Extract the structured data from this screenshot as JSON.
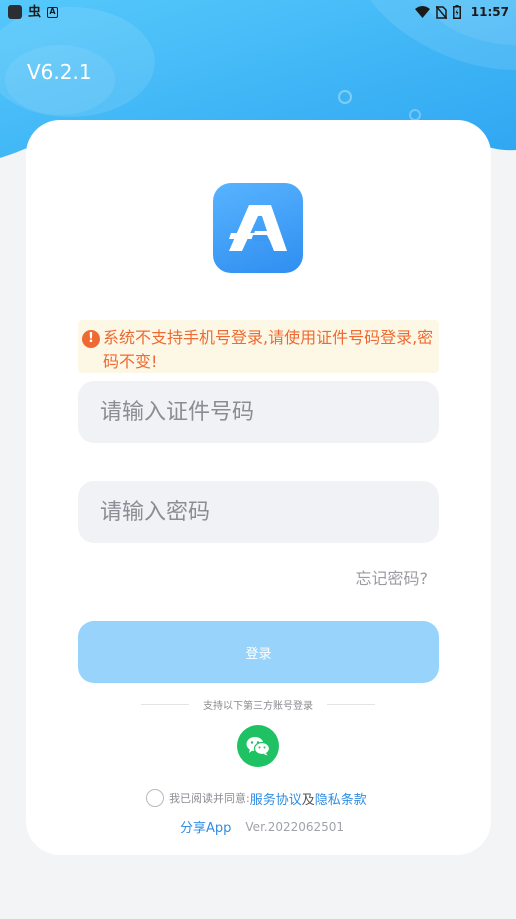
{
  "status_bar": {
    "left_glyph": "虫",
    "left_badge": "A",
    "time": "11:57"
  },
  "header": {
    "version": "V6.2.1"
  },
  "notice": {
    "icon": "!",
    "text": "系统不支持手机号登录,请使用证件号码登录,密码不变!"
  },
  "form": {
    "id_placeholder": "请输入证件号码",
    "password_placeholder": "请输入密码",
    "forgot_label": "忘记密码?",
    "login_label": "登录"
  },
  "third_party": {
    "label": "支持以下第三方账号登录",
    "wechat_icon": "wechat-icon"
  },
  "agreement": {
    "prefix": "我已阅读并同意:",
    "service_link": "服务协议",
    "and": "及",
    "privacy_link": "隐私条款"
  },
  "footer": {
    "share_label": "分享App",
    "version_label": "Ver.2022062501"
  },
  "colors": {
    "accent": "#2f8de4",
    "login_button": "#98d3fb",
    "notice_text": "#ee6a32",
    "notice_bg": "#fdf8e6",
    "wechat": "#1fc263"
  }
}
